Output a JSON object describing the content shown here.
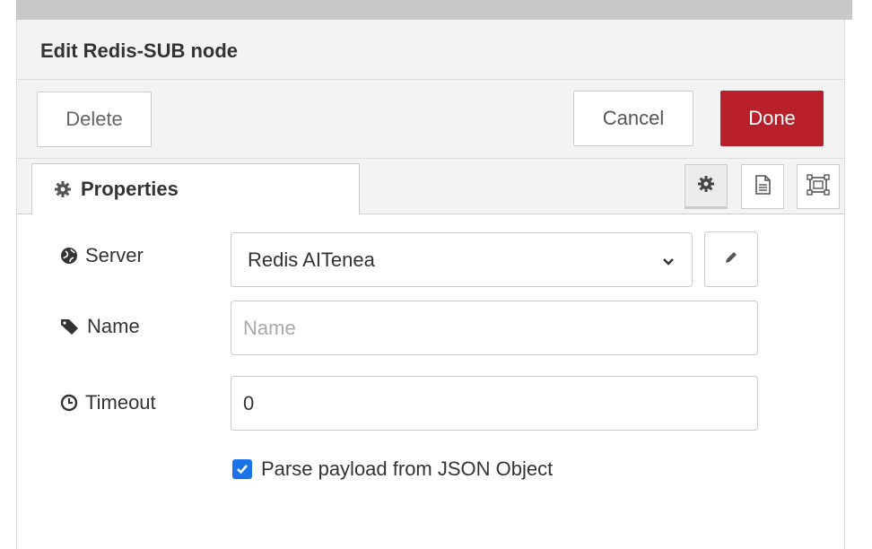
{
  "tray": {
    "title": "Edit Redis-SUB node",
    "delete_label": "Delete",
    "cancel_label": "Cancel",
    "done_label": "Done"
  },
  "tabs": {
    "properties_label": "Properties",
    "icons": [
      "gear-icon",
      "description-icon",
      "appearance-icon"
    ]
  },
  "form": {
    "server_label": "Server",
    "server_value": "Redis AITenea",
    "name_label": "Name",
    "name_value": "",
    "name_placeholder": "Name",
    "timeout_label": "Timeout",
    "timeout_value": "0",
    "parse_label": "Parse payload from JSON Object",
    "parse_checked": true
  },
  "colors": {
    "done": "#b8202a",
    "checkbox": "#1a73e8",
    "header_bg": "#f3f3f3"
  }
}
